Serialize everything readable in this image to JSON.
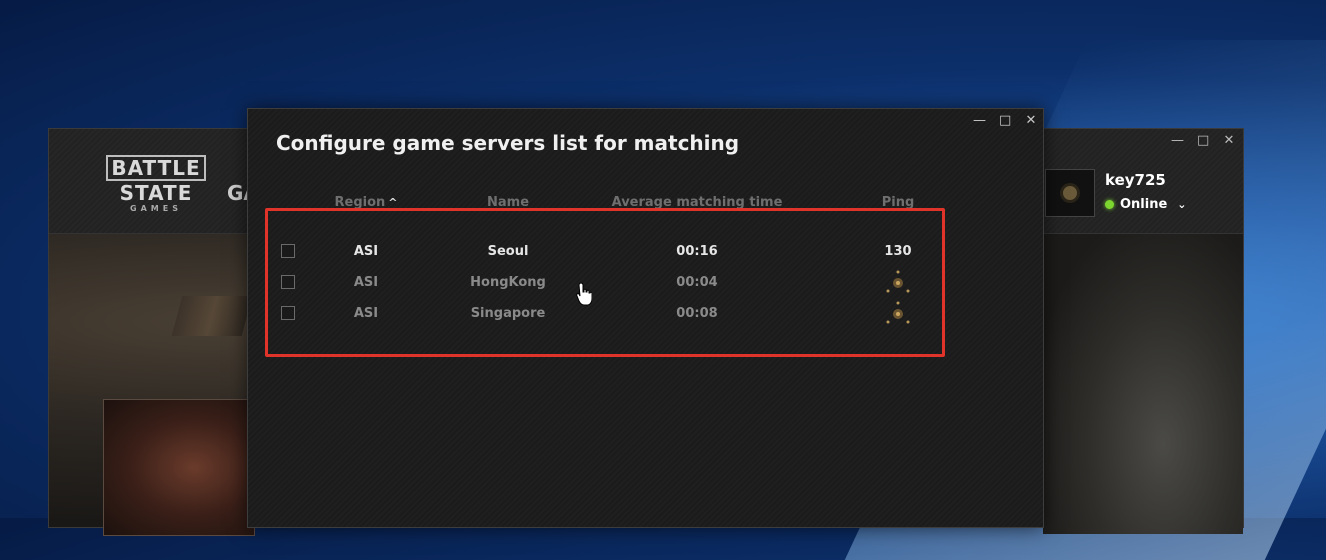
{
  "launcher": {
    "logo": {
      "line1": "BATTLE",
      "line2": "STATE",
      "line3": "GAMES"
    },
    "tab_fragment": "GA",
    "user": {
      "name": "key725",
      "status": "Online"
    },
    "window_buttons": {
      "minimize": "—",
      "maximize": "□",
      "close": "✕"
    }
  },
  "dialog": {
    "title": "Configure game servers list for matching",
    "window_buttons": {
      "minimize": "—",
      "maximize": "□",
      "close": "✕"
    },
    "columns": {
      "region": "Region",
      "name": "Name",
      "avg_time": "Average matching time",
      "ping": "Ping"
    },
    "sort_indicator": "^",
    "rows": [
      {
        "region": "ASI",
        "name": "Seoul",
        "avg_time": "00:16",
        "ping": "130"
      },
      {
        "region": "ASI",
        "name": "HongKong",
        "avg_time": "00:04",
        "ping": ""
      },
      {
        "region": "ASI",
        "name": "Singapore",
        "avg_time": "00:08",
        "ping": ""
      }
    ]
  },
  "colors": {
    "highlight": "#e0332a",
    "online": "#7dd62f"
  }
}
